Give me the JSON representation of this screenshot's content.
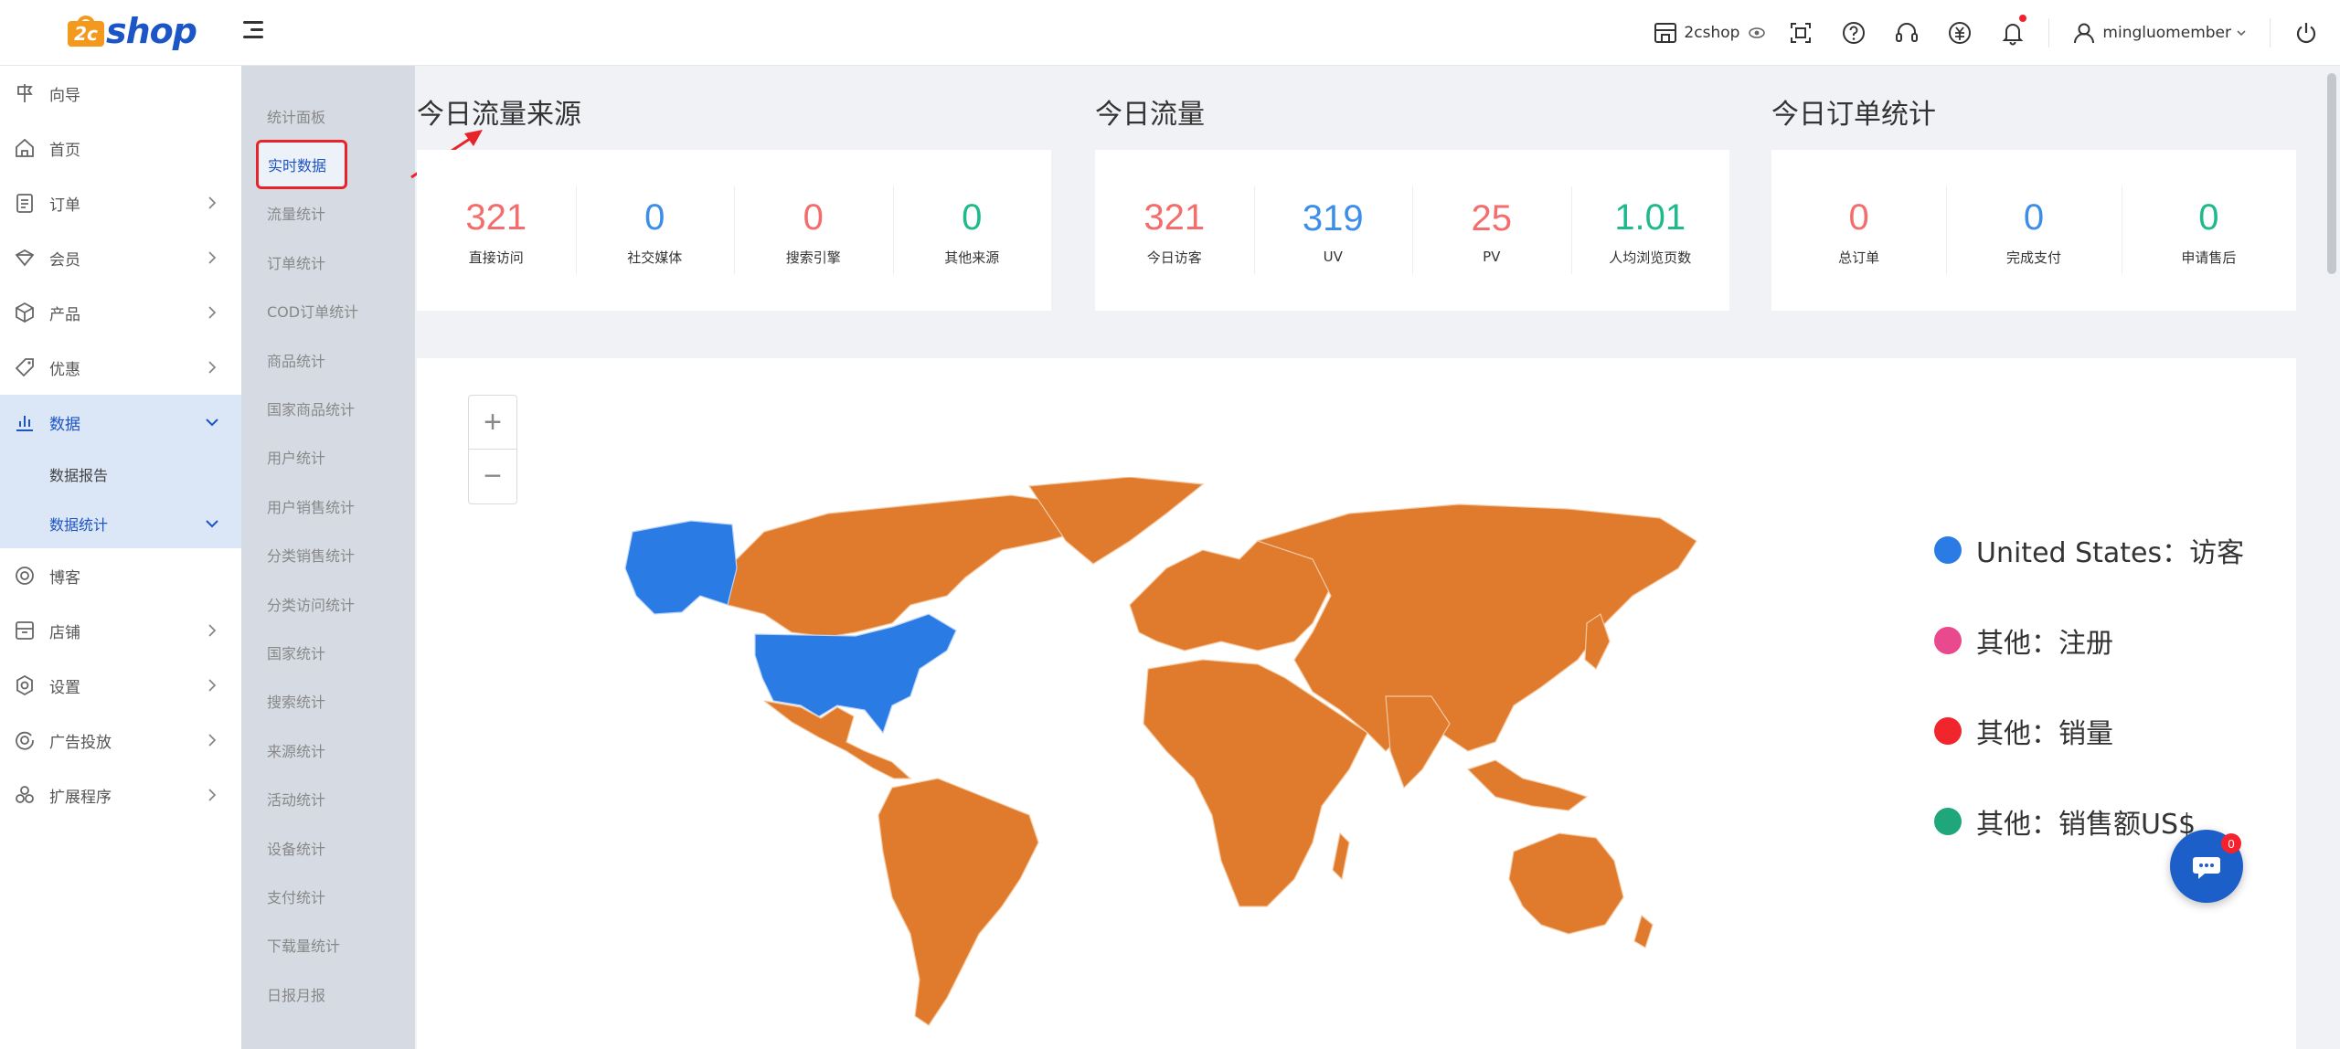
{
  "header": {
    "logo_number": "2c",
    "logo_text": "shop",
    "store_name": "2cshop",
    "username": "mingluomember",
    "icons": [
      "store-icon",
      "eye-icon",
      "scan-icon",
      "help-icon",
      "headset-icon",
      "currency-icon",
      "bell-icon",
      "user-icon",
      "power-icon"
    ],
    "alert_color": "#f5222d"
  },
  "sidebar": {
    "items": [
      {
        "label": "向导",
        "icon": "guide-icon"
      },
      {
        "label": "首页",
        "icon": "home-icon"
      },
      {
        "label": "订单",
        "icon": "order-icon",
        "has_children": true
      },
      {
        "label": "会员",
        "icon": "member-icon",
        "has_children": true
      },
      {
        "label": "产品",
        "icon": "product-icon",
        "has_children": true
      },
      {
        "label": "优惠",
        "icon": "discount-icon",
        "has_children": true
      },
      {
        "label": "数据",
        "icon": "chart-icon",
        "has_children": true,
        "expanded": true
      },
      {
        "label": "博客",
        "icon": "blog-icon"
      },
      {
        "label": "店铺",
        "icon": "store-icon",
        "has_children": true
      },
      {
        "label": "设置",
        "icon": "settings-icon",
        "has_children": true
      },
      {
        "label": "广告投放",
        "icon": "ads-icon",
        "has_children": true
      },
      {
        "label": "扩展程序",
        "icon": "extension-icon",
        "has_children": true
      }
    ],
    "data_children": [
      {
        "label": "数据报告"
      },
      {
        "label": "数据统计",
        "current": true
      }
    ],
    "accent_color": "#1d54c2"
  },
  "subnav": {
    "items": [
      "统计面板",
      "实时数据",
      "流量统计",
      "订单统计",
      "COD订单统计",
      "商品统计",
      "国家商品统计",
      "用户统计",
      "用户销售统计",
      "分类销售统计",
      "分类访问统计",
      "国家统计",
      "搜索统计",
      "来源统计",
      "活动统计",
      "设备统计",
      "支付统计",
      "下载量统计",
      "日报月报"
    ],
    "active": "实时数据"
  },
  "traffic_source": {
    "title": "今日流量来源",
    "stats": [
      {
        "value": "321",
        "label": "直接访问"
      },
      {
        "value": "0",
        "label": "社交媒体"
      },
      {
        "value": "0",
        "label": "搜索引擎"
      },
      {
        "value": "0",
        "label": "其他来源"
      }
    ]
  },
  "traffic": {
    "title": "今日流量",
    "stats": [
      {
        "value": "321",
        "label": "今日访客"
      },
      {
        "value": "319",
        "label": "UV"
      },
      {
        "value": "25",
        "label": "PV"
      },
      {
        "value": "1.01",
        "label": "人均浏览页数"
      }
    ]
  },
  "orders": {
    "title": "今日订单统计",
    "stats": [
      {
        "value": "0",
        "label": "总订单"
      },
      {
        "value": "0",
        "label": "完成支付"
      },
      {
        "value": "0",
        "label": "申请售后"
      }
    ]
  },
  "map": {
    "zoom_in": "+",
    "zoom_out": "−",
    "highlight_color": "#2b7be5",
    "base_color": "#e07b2e",
    "legend": [
      {
        "label": "United States：访客",
        "color": "#2b7be5"
      },
      {
        "label": "其他：注册",
        "color": "#e84a8d"
      },
      {
        "label": "其他：销量",
        "color": "#f0262c"
      },
      {
        "label": "其他：销售额US$",
        "color": "#1fa77b"
      }
    ]
  },
  "chat": {
    "badge": "0"
  }
}
